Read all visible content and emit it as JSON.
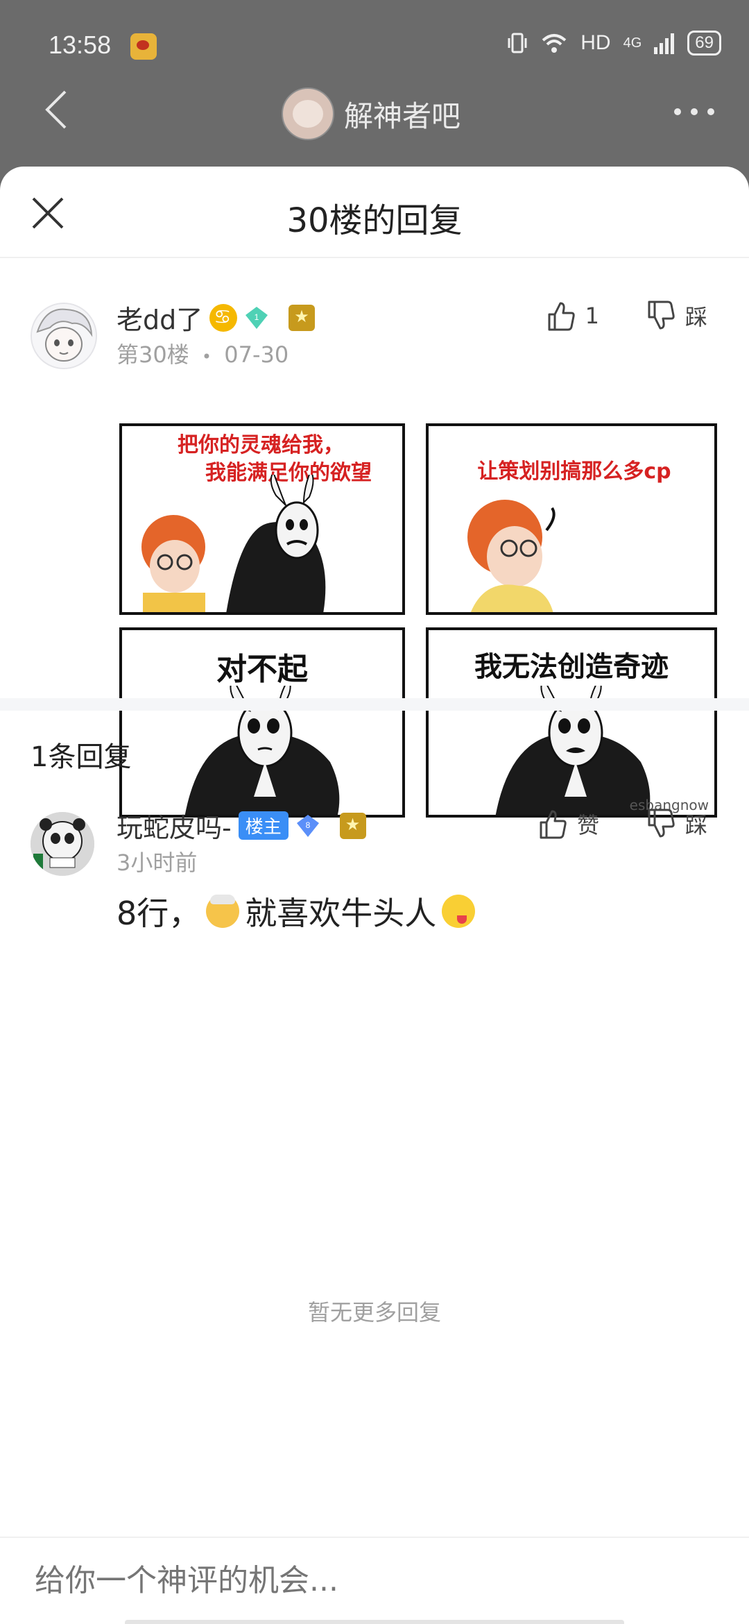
{
  "status_bar": {
    "time": "13:58",
    "network": "HD",
    "signal": "4G",
    "battery": "69"
  },
  "background_header": {
    "forum_name": "解神者吧"
  },
  "sheet": {
    "title": "30楼的回复"
  },
  "post": {
    "username": "老dd了",
    "level": "1",
    "floor": "第30楼",
    "separator": "•",
    "date": "07-30",
    "like_count": "1",
    "dislike_label": "踩",
    "meme": {
      "panel1_text_line1": "把你的灵魂给我，",
      "panel1_text_line2": "我能满足你的欲望",
      "panel2_text": "让策划别搞那么多cp",
      "panel3_text": "对不起",
      "panel4_text": "我无法创造奇迹",
      "watermark": "esbangnow"
    }
  },
  "replies": {
    "count_label": "1条回复",
    "items": [
      {
        "username": "玩蛇皮吗-",
        "owner_badge": "楼主",
        "level": "8",
        "time": "3小时前",
        "like_label": "赞",
        "dislike_label": "踩",
        "text_before": "8行，",
        "text_after": "就喜欢牛头人"
      }
    ],
    "no_more": "暂无更多回复"
  },
  "composer": {
    "placeholder": "给你一个神评的机会..."
  },
  "colors": {
    "accent_blue": "#3a8ef6",
    "meme_red": "#d62222",
    "muted_text": "#a0a0a0"
  }
}
